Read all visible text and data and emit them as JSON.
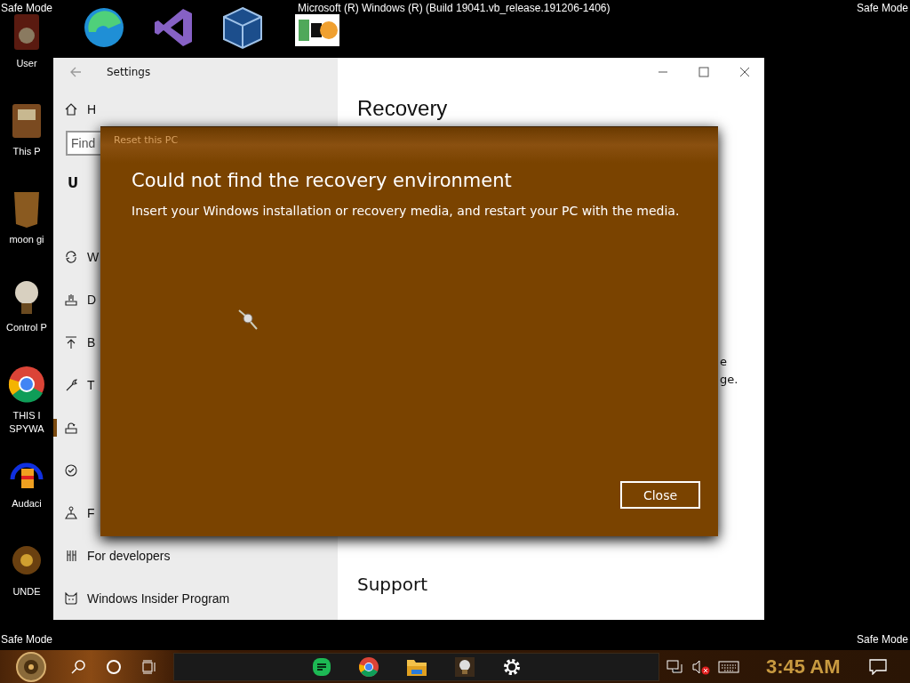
{
  "desktop": {
    "banner": "Microsoft (R) Windows (R) (Build 19041.vb_release.191206-1406)",
    "corner_labels": [
      "Safe Mode",
      "Safe Mode",
      "Safe Mode",
      "Safe Mode"
    ],
    "icons": [
      {
        "lines": [
          "User"
        ]
      },
      {
        "lines": [
          "This P"
        ]
      },
      {
        "lines": [
          "moon gi"
        ]
      },
      {
        "lines": [
          "Control P"
        ]
      },
      {
        "lines": [
          "THIS I",
          "SPYWA"
        ]
      },
      {
        "lines": [
          "Audaci"
        ]
      },
      {
        "lines": [
          "UNDE"
        ]
      }
    ]
  },
  "settings": {
    "title": "Settings",
    "home": "H",
    "search": {
      "placeholder": "Find"
    },
    "heading": "U",
    "items": [
      {
        "label": "W",
        "selected": false
      },
      {
        "label": "D",
        "selected": false
      },
      {
        "label": "B",
        "selected": false
      },
      {
        "label": "T",
        "selected": false
      },
      {
        "selected": true
      },
      {
        "selected": false
      },
      {
        "label": "F",
        "selected": false
      },
      {
        "label": "For developers",
        "selected": false
      },
      {
        "label": "Windows Insider Program",
        "selected": false
      }
    ],
    "page_title": "Recovery",
    "fragments": [
      "e",
      "ge."
    ],
    "section": "Support"
  },
  "dialog": {
    "title": "Reset this PC",
    "heading": "Could not find the recovery environment",
    "message": "Insert your Windows installation or recovery media, and restart your PC with the media.",
    "button": "Close"
  },
  "taskbar": {
    "clock": "3:45 AM",
    "volume_muted": true
  }
}
